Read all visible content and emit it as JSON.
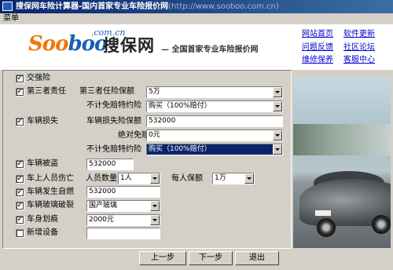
{
  "window": {
    "title": "搜保网车险计算器-国内首家专业车险报价网",
    "title_url": "(http://www.sooboo.com.cn)"
  },
  "menu": {
    "label": "菜单"
  },
  "brand": {
    "logo": "Sooboo",
    "domain": ".com.cn",
    "name_cn": "搜保网",
    "slogan": "— 全国首家专业车险报价网"
  },
  "links": [
    "网站首页",
    "软件更新",
    "问题反馈",
    "社区论坛",
    "维修保养",
    "客服中心"
  ],
  "form": {
    "jiaoqiang": {
      "label": "交强险",
      "checked": true
    },
    "third": {
      "label": "第三者责任",
      "checked": true,
      "amount_label": "第三者任险保额",
      "amount": "5万",
      "nodeduct_label": "不计免赔特约险",
      "nodeduct": "购买（100%赔付）"
    },
    "loss": {
      "label": "车辆损失",
      "checked": true,
      "amount_label": "车辆损失险保额",
      "amount": "532000",
      "deduct_label": "绝对免赔",
      "deduct": "0元",
      "nodeduct_label": "不计免赔特约险",
      "nodeduct": "购买（100%赔付）"
    },
    "theft": {
      "label": "车辆被盗",
      "checked": true,
      "value": "532000"
    },
    "passenger": {
      "label": "车上人员伤亡",
      "checked": true,
      "count_label": "人员数量",
      "count": "1人",
      "per_label": "每人保额",
      "per": "1万"
    },
    "fire": {
      "label": "车辆发生自燃",
      "checked": true,
      "value": "532000"
    },
    "glass": {
      "label": "车辆玻璃破裂",
      "checked": true,
      "value": "国产玻璃"
    },
    "scratch": {
      "label": "车身划痕",
      "checked": true,
      "value": "2000元"
    },
    "newdevice": {
      "label": "新增设备",
      "checked": false,
      "value": ""
    }
  },
  "buttons": {
    "prev": "上一步",
    "next": "下一步",
    "exit": "退出"
  }
}
